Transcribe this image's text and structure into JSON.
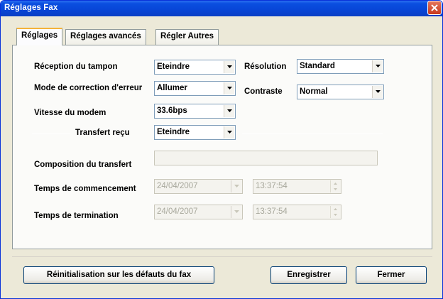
{
  "window": {
    "title": "Réglages Fax"
  },
  "tabs": [
    {
      "label": "Réglages"
    },
    {
      "label": "Réglages avancés"
    },
    {
      "label": "Régler Autres"
    }
  ],
  "form": {
    "reception_label": "Réception du tampon",
    "reception_value": "Eteindre",
    "resolution_label": "Résolution",
    "resolution_value": "Standard",
    "ecm_label": "Mode de correction d'erreur",
    "ecm_value": "Allumer",
    "contrast_label": "Contraste",
    "contrast_value": "Normal",
    "modem_label": "Vitesse du modem",
    "modem_value": "33.6bps",
    "forward_label": "Transfert reçu",
    "forward_value": "Eteindre",
    "dial_label": "Composition du transfert",
    "dial_value": "",
    "start_label": "Temps de commencement",
    "start_date": "24/04/2007",
    "start_time": "13:37:54",
    "end_label": "Temps de termination",
    "end_date": "24/04/2007",
    "end_time": "13:37:54"
  },
  "buttons": {
    "reset": "Réinitialisation sur les défauts du fax",
    "save": "Enregistrer",
    "close": "Fermer"
  },
  "icons": {
    "close": "close-icon",
    "dropdown": "chevron-down-icon",
    "spin": "spin-arrows-icon"
  }
}
